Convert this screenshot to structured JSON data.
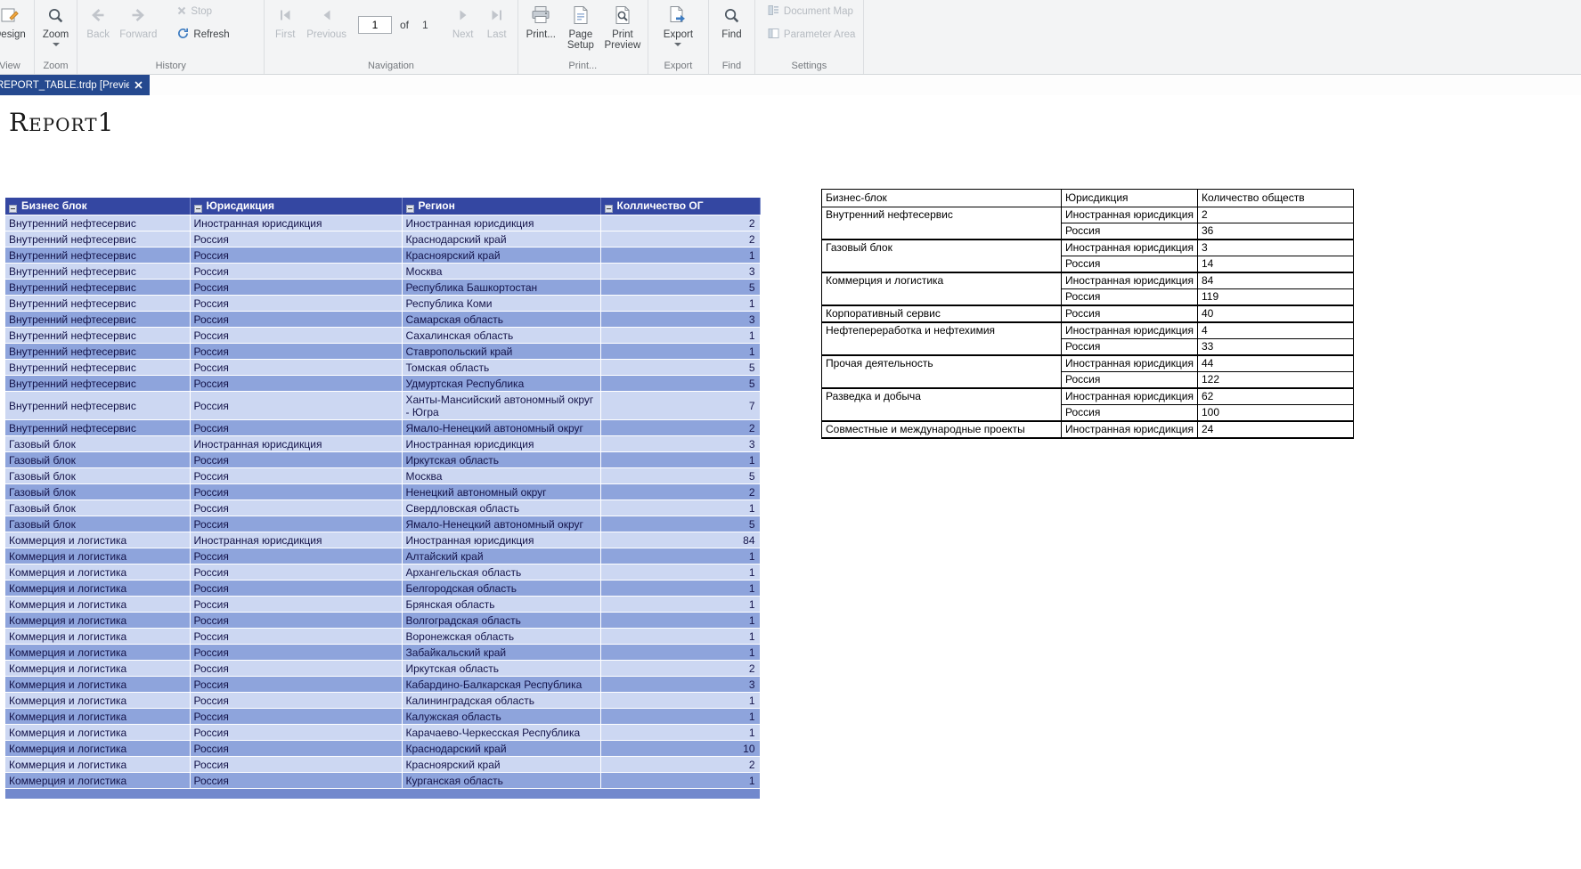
{
  "ribbon": {
    "view_group": {
      "label": "View",
      "design": "Design"
    },
    "zoom_group": {
      "label": "Zoom",
      "zoom": "Zoom"
    },
    "history_group": {
      "label": "History",
      "back": "Back",
      "forward": "Forward",
      "stop": "Stop",
      "refresh": "Refresh"
    },
    "navigation_group": {
      "label": "Navigation",
      "first": "First",
      "previous": "Previous",
      "page": "1",
      "of": "of",
      "total": "1",
      "next": "Next",
      "last": "Last"
    },
    "print_group": {
      "label": "Print...",
      "print": "Print...",
      "page_setup": "Page Setup",
      "print_preview": "Print Preview"
    },
    "export_group": {
      "label": "Export",
      "export": "Export"
    },
    "find_group": {
      "label": "Find",
      "find": "Find"
    },
    "settings_group": {
      "label": "Settings",
      "document_map": "Document Map",
      "parameter_area": "Parameter Area"
    }
  },
  "tab": {
    "title": "REPORT_TABLE.trdp [Preview]"
  },
  "report": {
    "title": "Report1"
  },
  "colors": {
    "tab_blue": "#25498f",
    "table_header_blue": "#3447a2",
    "row_light": "#ccd7f2",
    "row_dark": "#8ea4dc",
    "row_partial": "#7289cd"
  },
  "left_table": {
    "headers": [
      "Бизнес блок",
      "Юрисдикция",
      "Регион",
      "Колличество ОГ"
    ],
    "rows": [
      {
        "cells": [
          "Внутренний нефтесервис",
          "Иностранная юрисдикция",
          "Иностранная юрисдикция",
          "2"
        ],
        "shade": "light"
      },
      {
        "cells": [
          "Внутренний нефтесервис",
          "Россия",
          "Краснодарский край",
          "2"
        ],
        "shade": "light"
      },
      {
        "cells": [
          "Внутренний нефтесервис",
          "Россия",
          "Красноярский край",
          "1"
        ],
        "shade": "dark"
      },
      {
        "cells": [
          "Внутренний нефтесервис",
          "Россия",
          "Москва",
          "3"
        ],
        "shade": "light"
      },
      {
        "cells": [
          "Внутренний нефтесервис",
          "Россия",
          "Республика Башкортостан",
          "5"
        ],
        "shade": "dark"
      },
      {
        "cells": [
          "Внутренний нефтесервис",
          "Россия",
          "Республика Коми",
          "1"
        ],
        "shade": "light"
      },
      {
        "cells": [
          "Внутренний нефтесервис",
          "Россия",
          "Самарская область",
          "3"
        ],
        "shade": "dark"
      },
      {
        "cells": [
          "Внутренний нефтесервис",
          "Россия",
          "Сахалинская область",
          "1"
        ],
        "shade": "light"
      },
      {
        "cells": [
          "Внутренний нефтесервис",
          "Россия",
          "Ставропольский край",
          "1"
        ],
        "shade": "dark"
      },
      {
        "cells": [
          "Внутренний нефтесервис",
          "Россия",
          "Томская область",
          "5"
        ],
        "shade": "light"
      },
      {
        "cells": [
          "Внутренний нефтесервис",
          "Россия",
          "Удмуртская Республика",
          "5"
        ],
        "shade": "dark"
      },
      {
        "cells": [
          "Внутренний нефтесервис",
          "Россия",
          "Ханты-Мансийский автономный округ - Югра",
          "7"
        ],
        "shade": "light"
      },
      {
        "cells": [
          "Внутренний нефтесервис",
          "Россия",
          "Ямало-Ненецкий автономный округ",
          "2"
        ],
        "shade": "dark"
      },
      {
        "cells": [
          "Газовый блок",
          "Иностранная юрисдикция",
          "Иностранная юрисдикция",
          "3"
        ],
        "shade": "light"
      },
      {
        "cells": [
          "Газовый блок",
          "Россия",
          "Иркутская область",
          "1"
        ],
        "shade": "dark"
      },
      {
        "cells": [
          "Газовый блок",
          "Россия",
          "Москва",
          "5"
        ],
        "shade": "light"
      },
      {
        "cells": [
          "Газовый блок",
          "Россия",
          "Ненецкий автономный округ",
          "2"
        ],
        "shade": "dark"
      },
      {
        "cells": [
          "Газовый блок",
          "Россия",
          "Свердловская область",
          "1"
        ],
        "shade": "light"
      },
      {
        "cells": [
          "Газовый блок",
          "Россия",
          "Ямало-Ненецкий автономный округ",
          "5"
        ],
        "shade": "dark"
      },
      {
        "cells": [
          "Коммерция и логистика",
          "Иностранная юрисдикция",
          "Иностранная юрисдикция",
          "84"
        ],
        "shade": "light"
      },
      {
        "cells": [
          "Коммерция и логистика",
          "Россия",
          "Алтайский край",
          "1"
        ],
        "shade": "dark"
      },
      {
        "cells": [
          "Коммерция и логистика",
          "Россия",
          "Архангельская область",
          "1"
        ],
        "shade": "light"
      },
      {
        "cells": [
          "Коммерция и логистика",
          "Россия",
          "Белгородская область",
          "1"
        ],
        "shade": "dark"
      },
      {
        "cells": [
          "Коммерция и логистика",
          "Россия",
          "Брянская область",
          "1"
        ],
        "shade": "light"
      },
      {
        "cells": [
          "Коммерция и логистика",
          "Россия",
          "Волгоградская область",
          "1"
        ],
        "shade": "dark"
      },
      {
        "cells": [
          "Коммерция и логистика",
          "Россия",
          "Воронежская область",
          "1"
        ],
        "shade": "light"
      },
      {
        "cells": [
          "Коммерция и логистика",
          "Россия",
          "Забайкальский край",
          "1"
        ],
        "shade": "dark"
      },
      {
        "cells": [
          "Коммерция и логистика",
          "Россия",
          "Иркутская область",
          "2"
        ],
        "shade": "light"
      },
      {
        "cells": [
          "Коммерция и логистика",
          "Россия",
          "Кабардино-Балкарская Республика",
          "3"
        ],
        "shade": "dark"
      },
      {
        "cells": [
          "Коммерция и логистика",
          "Россия",
          "Калининградская область",
          "1"
        ],
        "shade": "light"
      },
      {
        "cells": [
          "Коммерция и логистика",
          "Россия",
          "Калужская область",
          "1"
        ],
        "shade": "dark"
      },
      {
        "cells": [
          "Коммерция и логистика",
          "Россия",
          "Карачаево-Черкесская Республика",
          "1"
        ],
        "shade": "light"
      },
      {
        "cells": [
          "Коммерция и логистика",
          "Россия",
          "Краснодарский край",
          "10"
        ],
        "shade": "dark"
      },
      {
        "cells": [
          "Коммерция и логистика",
          "Россия",
          "Красноярский край",
          "2"
        ],
        "shade": "light"
      },
      {
        "cells": [
          "Коммерция и логистика",
          "Россия",
          "Курганская область",
          "1"
        ],
        "shade": "dark"
      }
    ]
  },
  "right_table": {
    "headers": [
      "Бизнес-блок",
      "Юрисдикция",
      "Количество обществ"
    ],
    "groups": [
      {
        "block": "Внутренний нефтесервис",
        "rows": [
          [
            "Иностранная юрисдикция",
            "2"
          ],
          [
            "Россия",
            "36"
          ]
        ]
      },
      {
        "block": "Газовый блок",
        "rows": [
          [
            "Иностранная юрисдикция",
            "3"
          ],
          [
            "Россия",
            "14"
          ]
        ]
      },
      {
        "block": "Коммерция и логистика",
        "rows": [
          [
            "Иностранная юрисдикция",
            "84"
          ],
          [
            "Россия",
            "119"
          ]
        ]
      },
      {
        "block": "Корпоративный сервис",
        "rows": [
          [
            "Россия",
            "40"
          ]
        ]
      },
      {
        "block": "Нефтепереработка и нефтехимия",
        "rows": [
          [
            "Иностранная юрисдикция",
            "4"
          ],
          [
            "Россия",
            "33"
          ]
        ]
      },
      {
        "block": "Прочая деятельность",
        "rows": [
          [
            "Иностранная юрисдикция",
            "44"
          ],
          [
            "Россия",
            "122"
          ]
        ]
      },
      {
        "block": "Разведка и добыча",
        "rows": [
          [
            "Иностранная юрисдикция",
            "62"
          ],
          [
            "Россия",
            "100"
          ]
        ]
      },
      {
        "block": "Совместные и международные проекты",
        "rows": [
          [
            "Иностранная юрисдикция",
            "24"
          ]
        ]
      }
    ]
  }
}
